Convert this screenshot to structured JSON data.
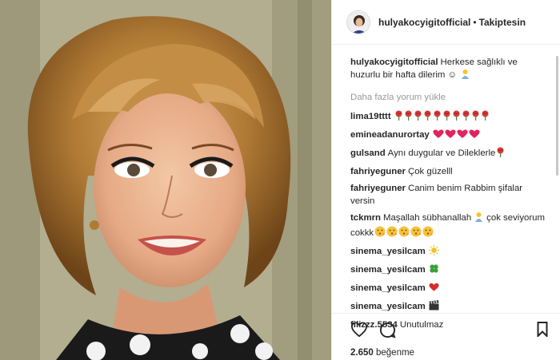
{
  "post": {
    "username": "hulyakocyigitofficial",
    "separator": "•",
    "follow_label": "Takiptesin",
    "caption_user": "hulyakocyigitofficial",
    "caption_text": "Herkese sağlıklı ve huzurlu bir hafta dilerim ☺",
    "load_more": "Daha fazla yorum yükle",
    "likes_count": "2.650",
    "likes_label": "beğenme"
  },
  "comments": [
    {
      "user": "lima19tttt",
      "text": "",
      "emoji": "rose-emoji",
      "count": 10
    },
    {
      "user": "emineadanurortay",
      "text": "",
      "emoji": "heart-emoji",
      "count": 4
    },
    {
      "user": "gulsand",
      "text": "Aynı duygular ve Dileklerle",
      "emoji": "rose-emoji",
      "count": 1
    },
    {
      "user": "fahriyeguner",
      "text": "Çok güzelll",
      "emoji": "",
      "count": 0
    },
    {
      "user": "fahriyeguner",
      "text": "Canim benim Rabbim şifalar versin",
      "emoji": "",
      "count": 0
    },
    {
      "user": "tckmrn",
      "text": "Maşallah sübhanallah",
      "tail": "çok seviyorum cokkk",
      "emoji": "kiss-emoji",
      "count": 5
    },
    {
      "user": "sinema_yesilcam",
      "text": "",
      "emoji": "sun-emoji",
      "count": 1
    },
    {
      "user": "sinema_yesilcam",
      "text": "",
      "emoji": "clover-emoji",
      "count": 1
    },
    {
      "user": "sinema_yesilcam",
      "text": "",
      "emoji": "red-heart-emoji",
      "count": 1
    },
    {
      "user": "sinema_yesilcam",
      "text": "",
      "emoji": "clapper-emoji",
      "count": 1
    },
    {
      "user": "filizzz.5534",
      "text": "Unutulmaz",
      "emoji": "",
      "count": 0
    }
  ],
  "colors": {
    "rose": "#d63a3a",
    "heart": "#e0245e",
    "text": "#262626",
    "muted": "#999999"
  }
}
